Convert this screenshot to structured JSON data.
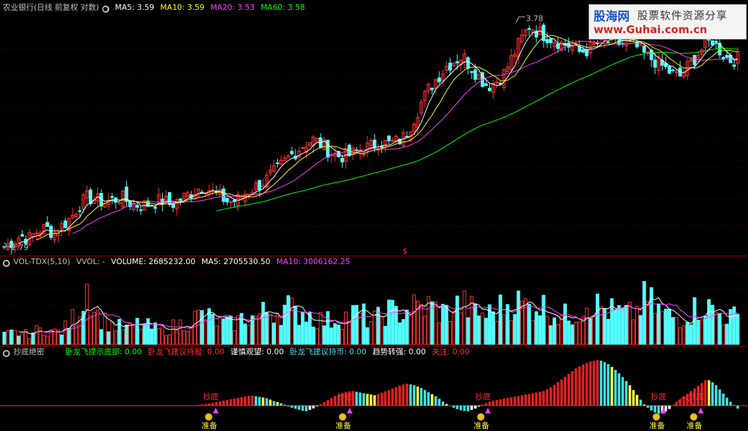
{
  "price_header": {
    "title": "农业银行(日线 前复权 对数)",
    "ma5_label": "MA5: 3.59",
    "ma10_label": "MA10: 3.59",
    "ma20_label": "MA20: 3.53",
    "ma60_label": "MA60: 3.58",
    "ma5_color": "#ffffff",
    "ma10_color": "#ffff00",
    "ma20_color": "#ff00ff",
    "ma60_color": "#00ff00",
    "high_label": "3.78",
    "low_label": "2.79",
    "marker": "$"
  },
  "vol_header": {
    "title": "VOL-TDX(5,10)",
    "vvol": "VVOL: -",
    "volume": "VOLUME: 2685232.00",
    "ma5": "MA5: 2705530.50",
    "ma10": "MA10: 3006162.25"
  },
  "ind_header": {
    "title": "抄底绝密",
    "f1": "卧龙飞提示底部: 0.00",
    "f2": "卧龙飞建议持股: 0.00",
    "f3": "谨慎观望: 0.00",
    "f4": "卧龙飞建议持币: 0.00",
    "f5": "趋势转强: 0.00",
    "f6": "关注: 0.00",
    "f1_color": "#00ff00",
    "f2_color": "#ff3030",
    "f3_color": "#ffffff",
    "f4_color": "#40e0e0",
    "f5_color": "#ffffff",
    "f6_color": "#ff3030"
  },
  "annotations": {
    "chaodi": "抄底",
    "zhunbei": "准备"
  },
  "logo": {
    "brand": "股海网",
    "slogan": "股票软件资源分享",
    "url": "www.Guhai.com.cn"
  },
  "chart_data": [
    {
      "type": "candlestick",
      "axis": "log",
      "ylim": [
        2.79,
        3.78
      ],
      "series": [
        {
          "name": "MA5",
          "color": "#ffffff"
        },
        {
          "name": "MA10",
          "color": "#ffff00"
        },
        {
          "name": "MA20",
          "color": "#ff00ff"
        },
        {
          "name": "MA60",
          "color": "#00ff00"
        }
      ],
      "close": [
        2.79,
        2.81,
        2.83,
        2.82,
        2.85,
        2.86,
        2.84,
        2.87,
        2.9,
        2.95,
        2.98,
        2.97,
        2.96,
        2.97,
        2.98,
        2.96,
        2.95,
        2.95,
        2.96,
        2.97,
        2.95,
        2.97,
        2.99,
        3.01,
        3.03,
        3.0,
        2.98,
        2.96,
        2.97,
        3.0,
        3.02,
        3.04,
        3.07,
        3.1,
        3.14,
        3.17,
        3.2,
        3.22,
        3.2,
        3.17,
        3.15,
        3.15,
        3.16,
        3.18,
        3.19,
        3.21,
        3.2,
        3.21,
        3.23,
        3.3,
        3.38,
        3.45,
        3.5,
        3.55,
        3.58,
        3.6,
        3.55,
        3.5,
        3.46,
        3.48,
        3.52,
        3.6,
        3.68,
        3.75,
        3.72,
        3.7,
        3.68,
        3.66,
        3.65,
        3.62,
        3.63,
        3.66,
        3.67,
        3.67,
        3.66,
        3.66,
        3.64,
        3.6,
        3.58,
        3.55,
        3.52,
        3.5,
        3.55,
        3.6,
        3.65,
        3.68,
        3.62,
        3.58,
        3.59
      ],
      "high": 3.78,
      "low": 2.79
    },
    {
      "type": "bar",
      "title": "VOL-TDX(5,10)",
      "series": [
        {
          "name": "VOLUME"
        },
        {
          "name": "MA5"
        },
        {
          "name": "MA10"
        }
      ],
      "values": [
        12,
        15,
        14,
        13,
        18,
        20,
        16,
        17,
        30,
        45,
        80,
        40,
        30,
        25,
        22,
        20,
        26,
        24,
        20,
        18,
        22,
        25,
        30,
        35,
        38,
        32,
        28,
        25,
        30,
        36,
        34,
        40,
        45,
        42,
        50,
        38,
        44,
        35,
        32,
        30,
        34,
        36,
        40,
        38,
        30,
        34,
        44,
        40,
        42,
        48,
        46,
        50,
        44,
        40,
        48,
        52,
        45,
        40,
        38,
        44,
        50,
        56,
        52,
        48,
        54,
        46,
        40,
        36,
        38,
        44,
        58,
        50,
        46,
        42,
        40,
        38,
        44,
        60,
        48,
        40,
        36,
        34,
        40,
        46,
        50,
        44,
        38,
        36,
        34
      ]
    },
    {
      "type": "bar",
      "title": "抄底绝密",
      "values": [
        0,
        0,
        0,
        0,
        0,
        0,
        0,
        0,
        0,
        0,
        0,
        0,
        0,
        0,
        0,
        0,
        0,
        0,
        0,
        0,
        0,
        0,
        0,
        0,
        0,
        1,
        2,
        4,
        6,
        8,
        10,
        12,
        14,
        12,
        10,
        6,
        3,
        -2,
        -5,
        -8,
        -4,
        2,
        8,
        14,
        18,
        20,
        18,
        16,
        14,
        18,
        22,
        26,
        30,
        28,
        24,
        18,
        12,
        4,
        -2,
        -6,
        -8,
        -4,
        2,
        6,
        8,
        10,
        12,
        14,
        16,
        18,
        20,
        26,
        34,
        42,
        50,
        56,
        60,
        62,
        58,
        50,
        40,
        28,
        14,
        0,
        -8,
        -12,
        -6,
        4,
        12,
        20,
        28,
        36,
        30,
        18,
        6,
        -4
      ]
    }
  ]
}
